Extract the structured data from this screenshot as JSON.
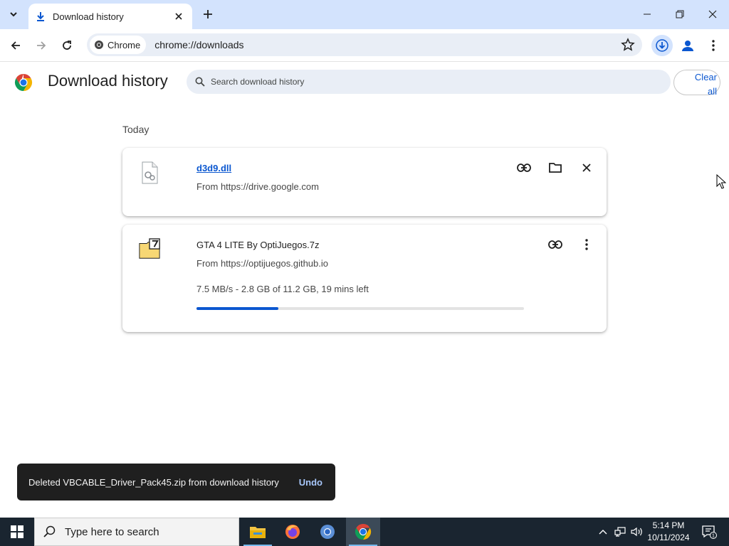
{
  "browser": {
    "tab_title": "Download history",
    "chip_label": "Chrome",
    "url": "chrome://downloads"
  },
  "page": {
    "title": "Download history",
    "search_placeholder": "Search download history",
    "clear_all": [
      "Clear",
      "all"
    ],
    "section_label": "Today"
  },
  "downloads": [
    {
      "name": "d3d9.dll",
      "source": "From https://drive.google.com"
    },
    {
      "name": "GTA 4 LITE By OptiJuegos.7z",
      "source": "From https://optijuegos.github.io",
      "status": "7.5 MB/s - 2.8 GB of 11.2 GB, 19 mins left",
      "progress_fraction": 0.25
    }
  ],
  "toast": {
    "message": "Deleted VBCABLE_Driver_Pack45.zip from download history",
    "undo": "Undo"
  },
  "taskbar": {
    "search_placeholder": "Type here to search",
    "time": "5:14 PM",
    "date": "10/11/2024",
    "notification_count": "1"
  },
  "colors": {
    "accent": "#0b57d0",
    "tabstrip": "#d3e3fd",
    "taskbar": "#1a2530"
  }
}
